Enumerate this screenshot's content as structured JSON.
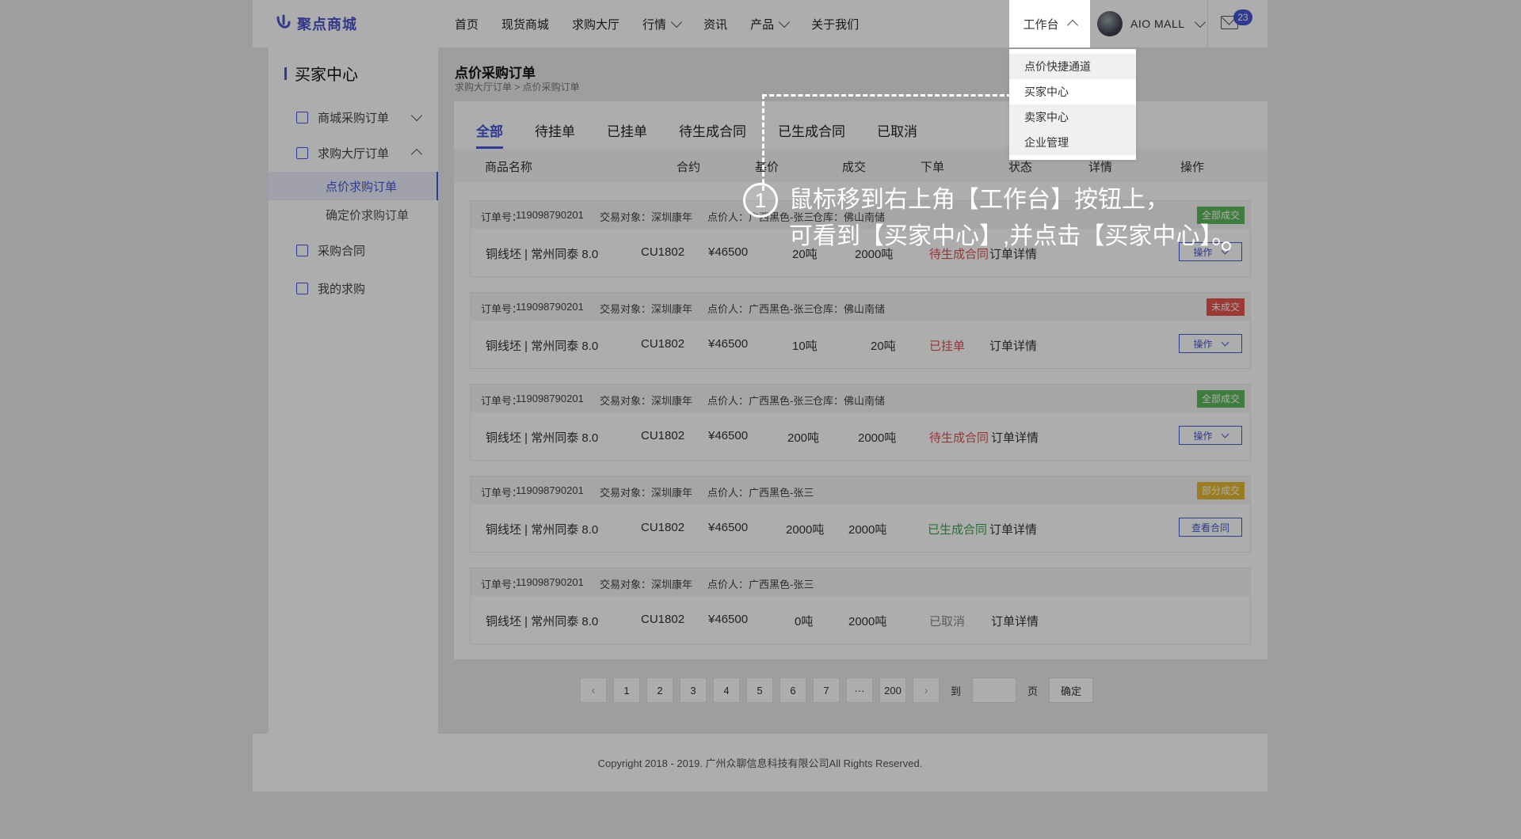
{
  "header": {
    "logo_text": "聚点商城",
    "nav": [
      "首页",
      "现货商城",
      "求购大厅",
      "行情",
      "资讯",
      "产品",
      "关于我们"
    ],
    "workbench_label": "工作台",
    "user_name": "AIO MALL",
    "mail_badge": "23"
  },
  "dropdown": {
    "items": [
      "点价快捷通道",
      "买家中心",
      "卖家中心",
      "企业管理"
    ],
    "selected": "买家中心"
  },
  "sidebar": {
    "title": "买家中心",
    "items": [
      {
        "label": "商城采购订单",
        "icon": "store-icon"
      },
      {
        "label": "求购大厅订单",
        "icon": "list-icon"
      },
      {
        "label": "采购合同",
        "icon": "contract-icon"
      },
      {
        "label": "我的求购",
        "icon": "request-icon"
      }
    ],
    "sub_items": [
      "点价求购订单",
      "确定价求购订单"
    ],
    "active_sub": "点价求购订单"
  },
  "main": {
    "title": "点价采购订单",
    "breadcrumb": "求购大厅订单 > 点价采购订单",
    "tabs": [
      "全部",
      "待挂单",
      "已挂单",
      "待生成合同",
      "已生成合同",
      "已取消"
    ],
    "active_tab": "全部",
    "columns": [
      "商品名称",
      "合约",
      "基价",
      "成交",
      "下单",
      "状态",
      "详情",
      "操作"
    ],
    "orders": [
      {
        "order_no_label": "订单号：",
        "order_no": "119098790201",
        "party": "交易对象：深圳康年",
        "pricer": "点价人：广西黑色-张三",
        "warehouse": "仓库：佛山南储",
        "product": "铜线坯 | 常州同泰 8.0",
        "contract": "CU1802",
        "price": "¥46500",
        "deal": "20吨",
        "ordered": "2000吨",
        "status": "待生成合同",
        "status_color": "#d9534f",
        "detail": "订单详情",
        "op": "操作",
        "tag": "全部成交",
        "tag_color": "#5cb85c"
      },
      {
        "order_no_label": "订单号：",
        "order_no": "119098790201",
        "party": "交易对象：深圳康年",
        "pricer": "点价人：广西黑色-张三",
        "warehouse": "仓库：佛山南储",
        "product": "铜线坯 | 常州同泰 8.0",
        "contract": "CU1802",
        "price": "¥46500",
        "deal": "10吨",
        "ordered": "20吨",
        "status": "已挂单",
        "status_color": "#d9534f",
        "detail": "订单详情",
        "op": "操作",
        "tag": "未成交",
        "tag_color": "#e8534a"
      },
      {
        "order_no_label": "订单号：",
        "order_no": "119098790201",
        "party": "交易对象：深圳康年",
        "pricer": "点价人：广西黑色-张三",
        "warehouse": "仓库：佛山南储",
        "product": "铜线坯 | 常州同泰 8.0",
        "contract": "CU1802",
        "price": "¥46500",
        "deal": "200吨",
        "ordered": "2000吨",
        "status": "待生成合同",
        "status_color": "#d9534f",
        "detail": "订单详情",
        "op": "操作",
        "tag": "全部成交",
        "tag_color": "#5cb85c"
      },
      {
        "order_no_label": "订单号：",
        "order_no": "119098790201",
        "party": "交易对象：深圳康年",
        "pricer": "点价人：广西黑色-张三",
        "warehouse": "",
        "product": "铜线坯 | 常州同泰 8.0",
        "contract": "CU1802",
        "price": "¥46500",
        "deal": "2000吨",
        "ordered": "2000吨",
        "status": "已生成合同",
        "status_color": "#3aa64b",
        "detail": "订单详情",
        "op": "查看合同",
        "tag": "部分成交",
        "tag_color": "#e5b930"
      },
      {
        "order_no_label": "订单号：",
        "order_no": "119098790201",
        "party": "交易对象：深圳康年",
        "pricer": "点价人：广西黑色-张三",
        "warehouse": "",
        "product": "铜线坯 | 常州同泰 8.0",
        "contract": "CU1802",
        "price": "¥46500",
        "deal": "0吨",
        "ordered": "2000吨",
        "status": "已取消",
        "status_color": "#888888",
        "detail": "订单详情",
        "op": "",
        "tag": "",
        "tag_color": ""
      }
    ]
  },
  "pagination": {
    "pages": [
      "1",
      "2",
      "3",
      "4",
      "5",
      "6",
      "7",
      "···",
      "200"
    ],
    "goto_label": "到",
    "page_unit": "页",
    "confirm": "确定"
  },
  "footer": {
    "copyright": "Copyright 2018 - 2019. 广州众聊信息科技有限公司All Rights Reserved."
  },
  "guide": {
    "step": "1",
    "line1": "鼠标移到右上角【工作台】按钮上，",
    "line2": "可看到【买家中心】,并点击【买家中心】。"
  },
  "colors": {
    "accent": "#4557d6",
    "overlay": "rgba(0,0,0,0.32)"
  }
}
